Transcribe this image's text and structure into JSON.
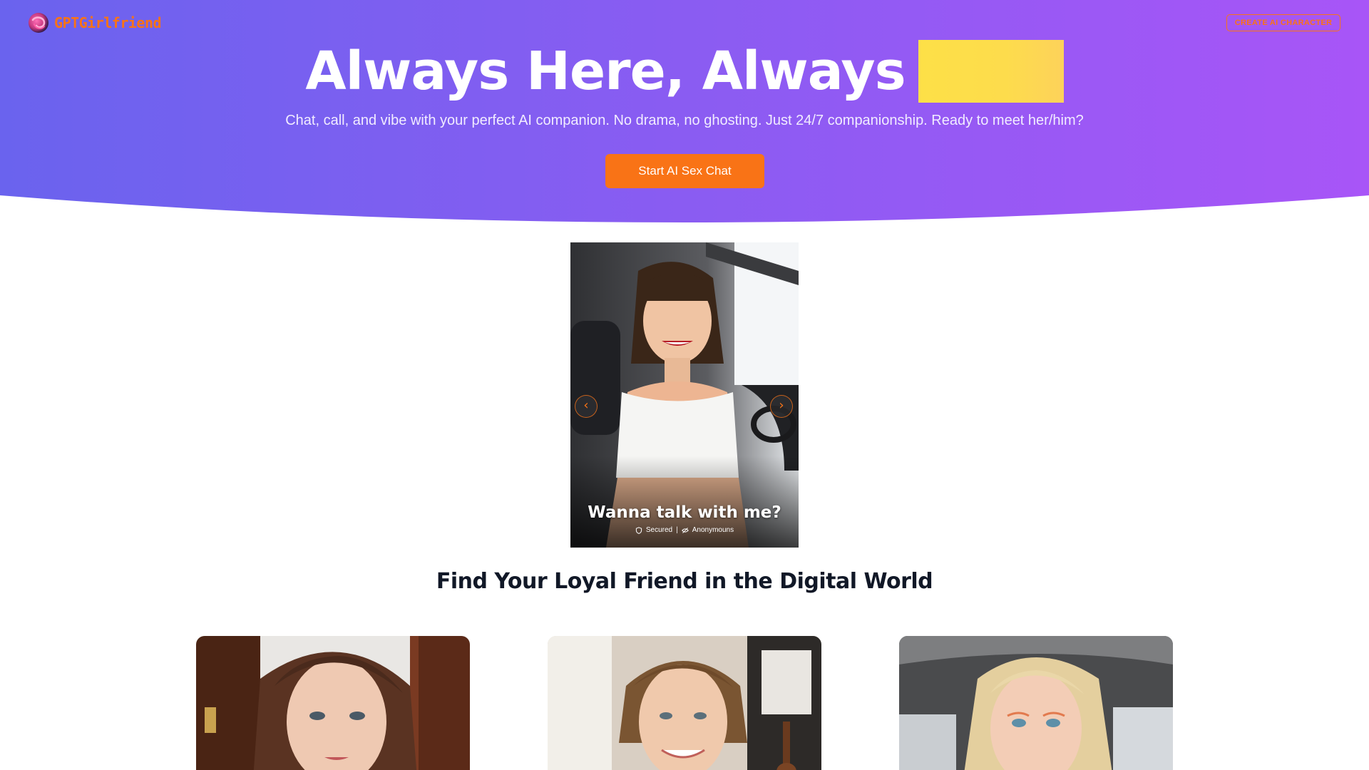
{
  "brand": {
    "name": "GPTGirlfriend",
    "logo_icon": "swirl-logo-icon"
  },
  "header": {
    "create_label": "CREATE AI CHARACTER"
  },
  "hero": {
    "title": "Always Here, Always",
    "subtitle": "Chat, call, and vibe with your perfect AI companion. No drama, no ghosting. Just 24/7 companionship. Ready to meet her/him?",
    "cta_label": "Start AI Sex Chat"
  },
  "featured": {
    "caption": "Wanna talk with me?",
    "meta_secured": "Secured",
    "meta_separator": "|",
    "meta_anonymous": "Anonymouns",
    "prev_icon": "chevron-left-icon",
    "next_icon": "chevron-right-icon"
  },
  "section": {
    "title": "Find Your Loyal Friend in the Digital World"
  },
  "colors": {
    "accent": "#f97316",
    "hero_start": "#6a63ee",
    "hero_end": "#a855f7",
    "highlight": "#fde047",
    "heading": "#111827"
  }
}
